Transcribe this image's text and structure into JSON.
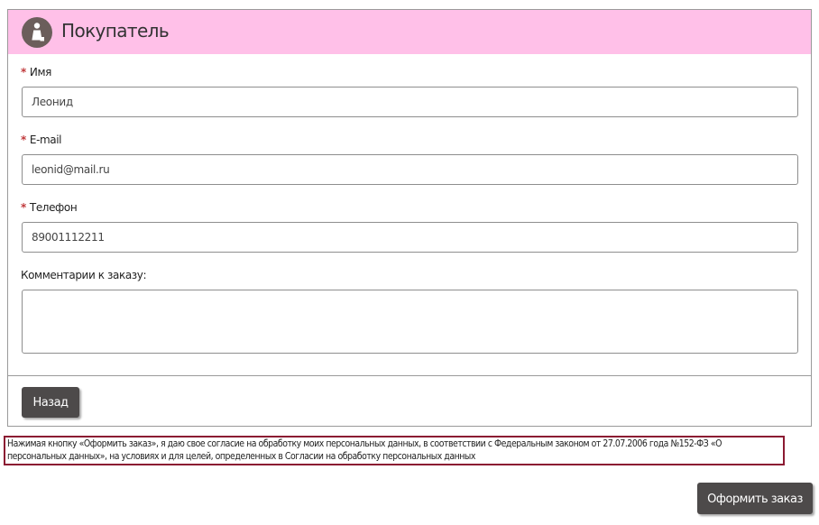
{
  "buyer_panel": {
    "title": "Покупатель",
    "icon": "person-bag-icon"
  },
  "form": {
    "name": {
      "label": "Имя",
      "required_mark": "*",
      "value": "Леонид"
    },
    "email": {
      "label": "E-mail",
      "required_mark": "*",
      "value": "leonid@mail.ru"
    },
    "phone": {
      "label": "Телефон",
      "required_mark": "*",
      "value": "89001112211"
    },
    "comment": {
      "label": "Комментарии к заказу:",
      "value": ""
    }
  },
  "buttons": {
    "back": "Назад",
    "submit": "Оформить заказ"
  },
  "consent_text": "Нажимая кнопку «Оформить заказ», я даю свое согласие на обработку моих персональных данных, в соответствии с Федеральным законом от 27.07.2006 года №152-ФЗ «О персональных данных», на условиях и для целей, определенных в Согласии на обработку персональных данных",
  "colors": {
    "header_bg": "#ffc0e8",
    "button_bg": "#4d4a4a",
    "required": "#c0393b",
    "consent_border": "#8b1a32"
  }
}
